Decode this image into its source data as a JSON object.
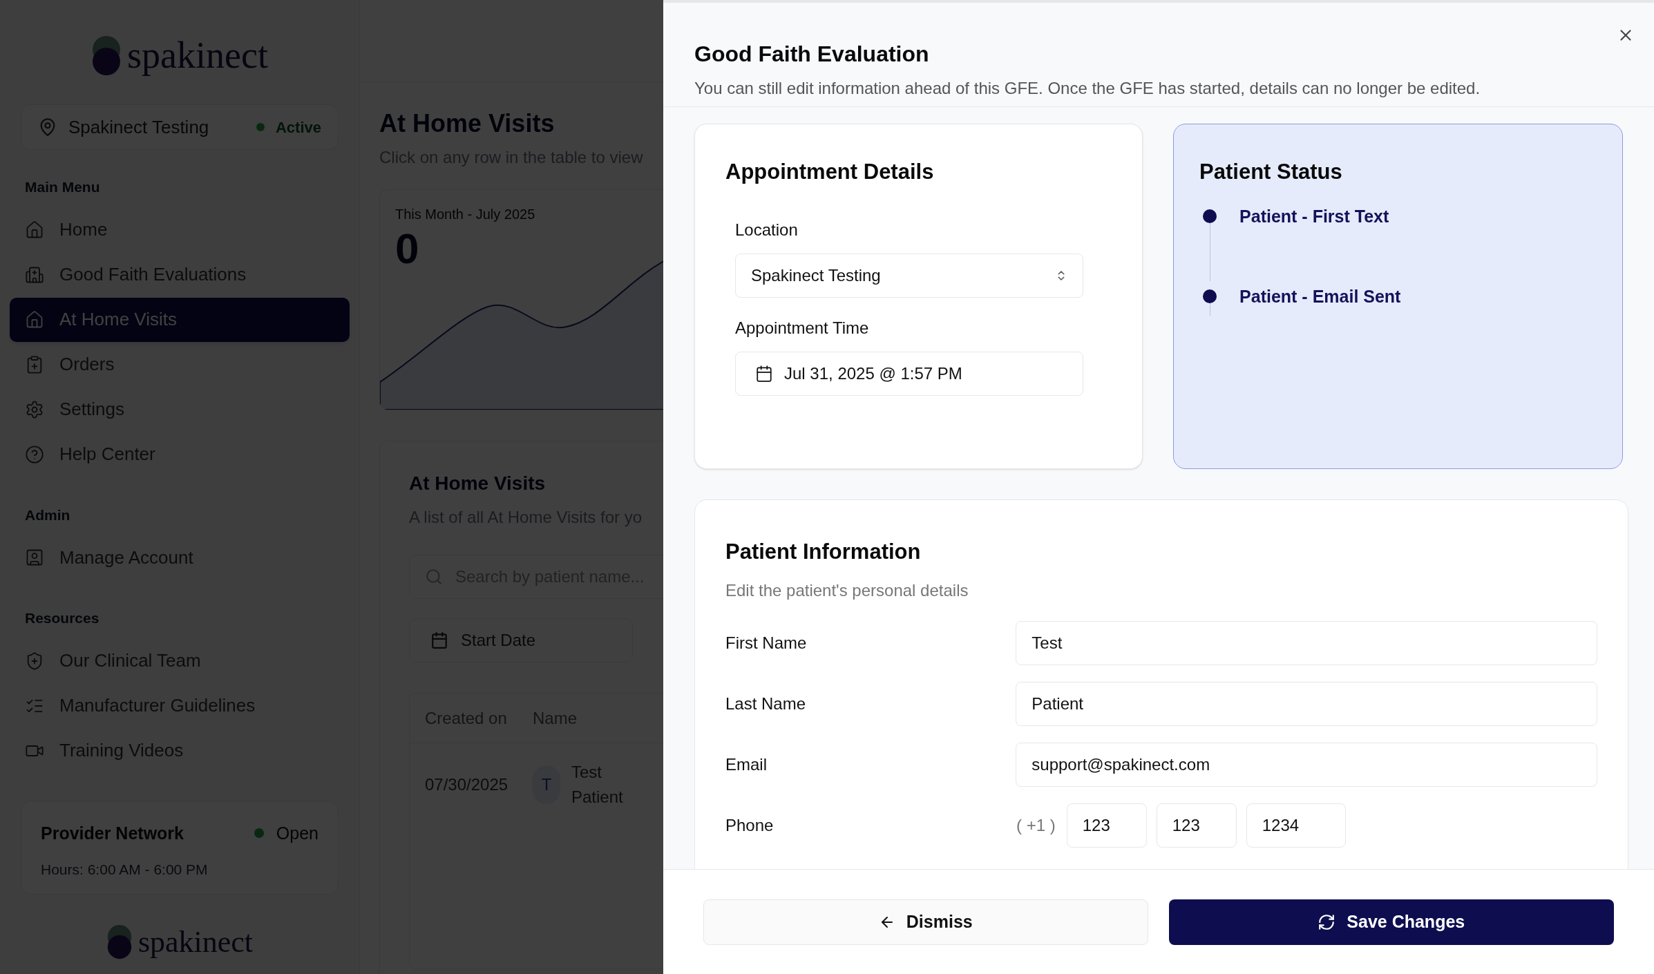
{
  "sidebar": {
    "logo": "spakinect",
    "location": {
      "name": "Spakinect Testing",
      "status": "Active"
    },
    "sections": [
      {
        "heading": "Main Menu",
        "items": [
          {
            "label": "Home",
            "selected": false
          },
          {
            "label": "Good Faith Evaluations",
            "selected": false
          },
          {
            "label": "At Home Visits",
            "selected": true
          },
          {
            "label": "Orders",
            "selected": false
          },
          {
            "label": "Settings",
            "selected": false
          },
          {
            "label": "Help Center",
            "selected": false
          }
        ]
      },
      {
        "heading": "Admin",
        "items": [
          {
            "label": "Manage Account",
            "selected": false
          }
        ]
      },
      {
        "heading": "Resources",
        "items": [
          {
            "label": "Our Clinical Team",
            "selected": false
          },
          {
            "label": "Manufacturer Guidelines",
            "selected": false
          },
          {
            "label": "Training Videos",
            "selected": false
          }
        ]
      }
    ],
    "provider_card": {
      "title": "Provider Network",
      "status": "Open",
      "hours": "Hours: 6:00 AM - 6:00 PM"
    },
    "footer_logo": "spakinect"
  },
  "page": {
    "title": "At Home Visits",
    "subtitle": "Click on any row in the table to view",
    "stat": {
      "label": "This Month - July 2025",
      "value": "0"
    },
    "list": {
      "title": "At Home Visits",
      "subtitle": "A list of all At Home Visits for yo",
      "search_placeholder": "Search by patient name...",
      "start_date": "Start Date",
      "columns": [
        "Created on",
        "Name"
      ],
      "rows": [
        {
          "created_on": "07/30/2025",
          "avatar": "T",
          "name": "Test Patient"
        }
      ]
    }
  },
  "dialog": {
    "title": "Good Faith Evaluation",
    "subtitle": "You can still edit information ahead of this GFE. Once the GFE has started, details can no longer be edited.",
    "appointment": {
      "title": "Appointment Details",
      "location_label": "Location",
      "location": "Spakinect Testing",
      "time_label": "Appointment Time",
      "time": "Jul 31, 2025 @ 1:57 PM"
    },
    "status": {
      "title": "Patient Status",
      "events": [
        "Patient - First Text",
        "Patient - Email Sent"
      ]
    },
    "patient": {
      "title": "Patient Information",
      "subtitle": "Edit the patient's personal details",
      "fields": [
        {
          "label": "First Name",
          "value": "Test"
        },
        {
          "label": "Last Name",
          "value": "Patient"
        },
        {
          "label": "Email",
          "value": "support@spakinect.com"
        }
      ],
      "phone": {
        "label": "Phone",
        "prefix": "( +1 )",
        "parts": [
          "123",
          "123",
          "1234"
        ]
      }
    },
    "buttons": {
      "dismiss": "Dismiss",
      "save": "Save Changes"
    }
  }
}
